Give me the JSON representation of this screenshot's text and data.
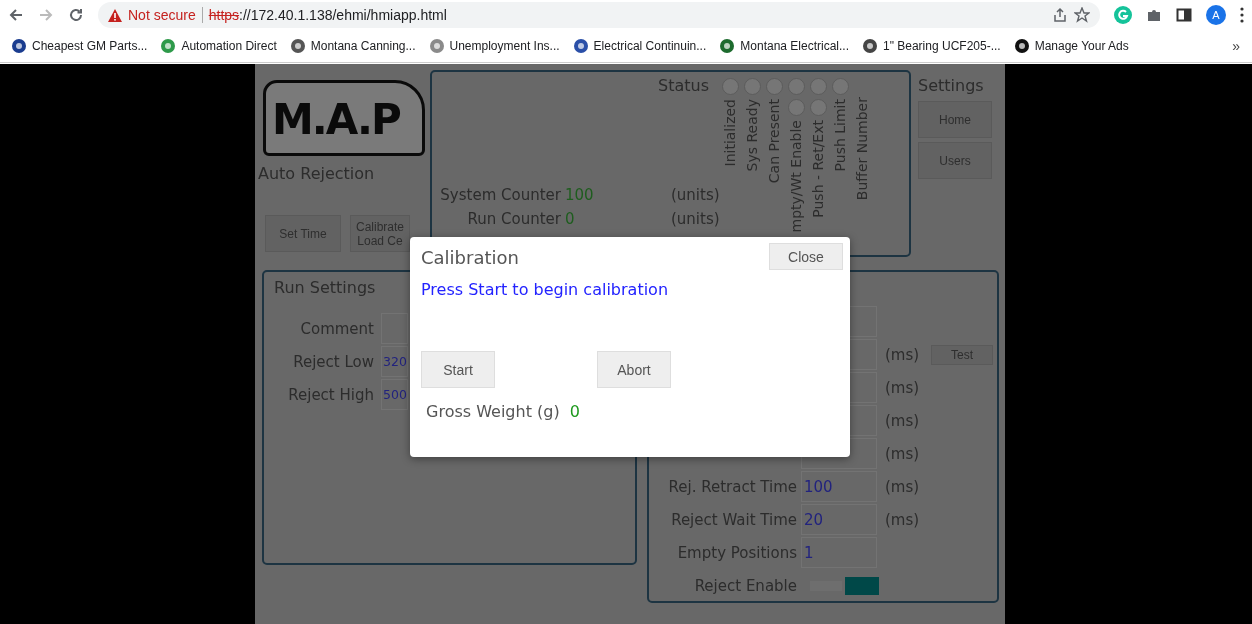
{
  "browser": {
    "warning": "Not secure",
    "url_scheme": "https",
    "url_rest": "://172.40.1.138/ehmi/hmiapp.html",
    "profile_initial": "A",
    "bookmarks": [
      {
        "label": "Cheapest GM Parts...",
        "color": "#1a3c8f"
      },
      {
        "label": "Automation Direct",
        "color": "#2e9a4a"
      },
      {
        "label": "Montana Canning...",
        "color": "#555555"
      },
      {
        "label": "Unemployment Ins...",
        "color": "#8a8a8a"
      },
      {
        "label": "Electrical Continuin...",
        "color": "#2a4fa8"
      },
      {
        "label": "Montana Electrical...",
        "color": "#1d6b2e"
      },
      {
        "label": "1\" Bearing UCF205-...",
        "color": "#444444"
      },
      {
        "label": "Manage Your Ads",
        "color": "#111111"
      }
    ],
    "more": "»"
  },
  "app": {
    "logo": "M.A.P",
    "subtitle": "Auto Rejection",
    "top_buttons": [
      "Set Time",
      "Calibrate Load Ce"
    ],
    "status": {
      "title": "Status",
      "indicators": [
        {
          "label": "Initialized",
          "kind": "lamp"
        },
        {
          "label": "Sys Ready",
          "kind": "lamp"
        },
        {
          "label": "Can Present",
          "kind": "lamp"
        },
        {
          "label": "mpty/Wt Enable",
          "kind": "lamp2"
        },
        {
          "label": "Push - Ret/Ext",
          "kind": "lamp2"
        },
        {
          "label": "Push Limit",
          "kind": "lamp"
        },
        {
          "label": "Buffer Number",
          "kind": "plain"
        }
      ],
      "counters": [
        {
          "label": "System Counter",
          "value": "100",
          "unit": "(units)"
        },
        {
          "label": "Run Counter",
          "value": "0",
          "unit": "(units)"
        }
      ]
    },
    "settings": {
      "title": "Settings",
      "buttons": [
        "Home",
        "Users"
      ]
    },
    "run_settings": {
      "title": "Run Settings",
      "fields": [
        {
          "label": "Comment"
        },
        {
          "label": "Reject Low",
          "value": "320"
        },
        {
          "label": "Reject High",
          "value": "500"
        }
      ]
    },
    "timing": [
      {
        "kind": "field"
      },
      {
        "kind": "field",
        "unit": "(ms)",
        "button": "Test"
      },
      {
        "kind": "field",
        "unit": "(ms)"
      },
      {
        "kind": "field",
        "unit": "(ms)"
      },
      {
        "kind": "field",
        "unit": "(ms)"
      },
      {
        "kind": "field",
        "label": "Rej. Retract Time",
        "value": "100",
        "unit": "(ms)"
      },
      {
        "kind": "field",
        "label": "Reject Wait Time",
        "value": "20",
        "unit": "(ms)"
      },
      {
        "kind": "field",
        "label": "Empty Positions",
        "value": "1"
      },
      {
        "kind": "toggle",
        "label": "Reject Enable",
        "on": true
      }
    ]
  },
  "dialog": {
    "title": "Calibration",
    "close": "Close",
    "message": "Press Start to begin calibration",
    "buttons": [
      "Start",
      "Abort"
    ],
    "readout": {
      "label": "Gross Weight (g)",
      "value": "0"
    }
  }
}
